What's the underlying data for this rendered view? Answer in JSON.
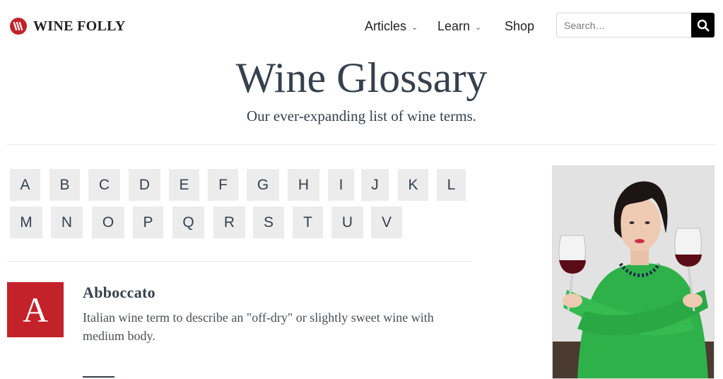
{
  "brand": {
    "name": "WINE FOLLY",
    "logo_color": "#c3222b"
  },
  "nav": {
    "items": [
      {
        "label": "Articles",
        "has_dropdown": true
      },
      {
        "label": "Learn",
        "has_dropdown": true
      },
      {
        "label": "Shop",
        "has_dropdown": false
      }
    ]
  },
  "search": {
    "placeholder": "Search…",
    "icon": "search-icon"
  },
  "hero": {
    "title": "Wine Glossary",
    "subtitle": "Our ever-expanding list of wine terms."
  },
  "letters": [
    "A",
    "B",
    "C",
    "D",
    "E",
    "F",
    "G",
    "H",
    "I",
    "J",
    "K",
    "L",
    "M",
    "N",
    "O",
    "P",
    "Q",
    "R",
    "S",
    "T",
    "U",
    "V"
  ],
  "entry": {
    "letter": "A",
    "term": "Abboccato",
    "definition": "Italian wine term to describe an \"off-dry\" or slightly sweet wine with medium body."
  },
  "colors": {
    "accent": "#c3222b",
    "text": "#36414d",
    "letter_bg": "#ececec",
    "search_button": "#000000"
  }
}
